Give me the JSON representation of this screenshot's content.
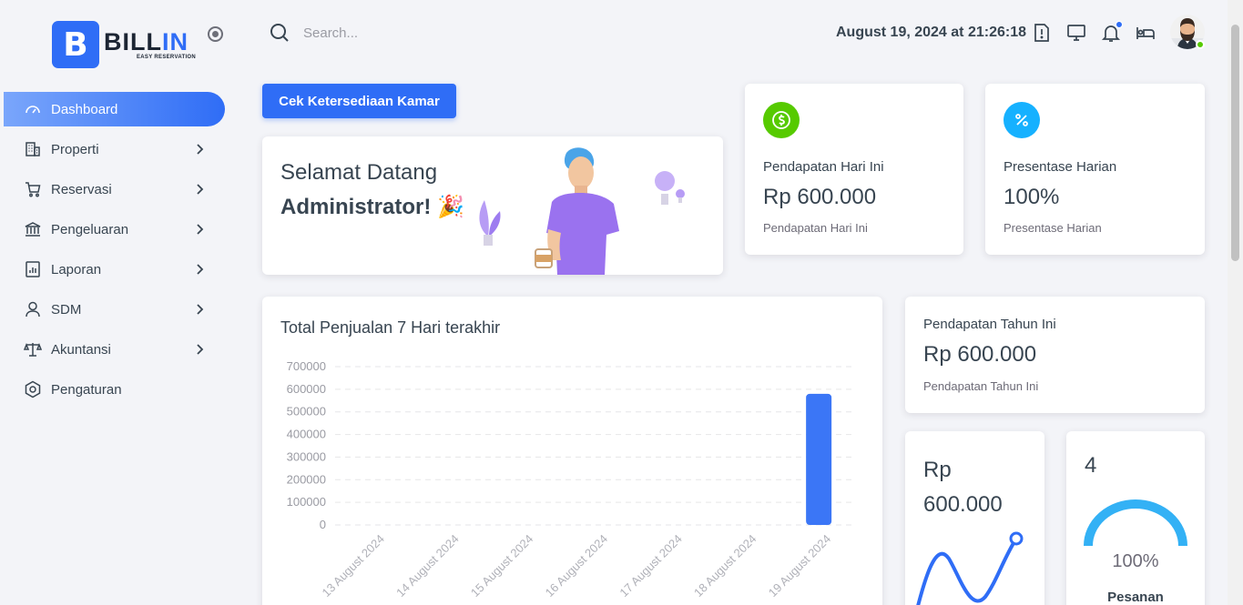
{
  "brand": {
    "name_prefix": "BILL",
    "name_suffix": "IN",
    "tagline": "EASY RESERVATION",
    "mark": "B",
    "accent": "#2f6df6"
  },
  "sidebar": {
    "items": [
      {
        "label": "Dashboard",
        "icon": "dashboard-gauge-icon",
        "active": true,
        "has_children": false
      },
      {
        "label": "Properti",
        "icon": "building-icon",
        "has_children": true
      },
      {
        "label": "Reservasi",
        "icon": "cart-icon",
        "has_children": true
      },
      {
        "label": "Pengeluaran",
        "icon": "bank-icon",
        "has_children": true
      },
      {
        "label": "Laporan",
        "icon": "report-icon",
        "has_children": true
      },
      {
        "label": "SDM",
        "icon": "user-icon",
        "has_children": true
      },
      {
        "label": "Akuntansi",
        "icon": "scale-icon",
        "has_children": true
      },
      {
        "label": "Pengaturan",
        "icon": "settings-hex-icon",
        "has_children": false
      }
    ]
  },
  "header": {
    "search_placeholder": "Search...",
    "datetime": "August 19, 2024 at 21:26:18"
  },
  "actions": {
    "check_availability": "Cek Ketersediaan Kamar"
  },
  "welcome": {
    "line1": "Selamat Datang",
    "line2": "Administrator! 🎉"
  },
  "stats": {
    "today": {
      "title": "Pendapatan Hari Ini",
      "value": "Rp 600.000",
      "sub": "Pendapatan Hari Ini",
      "icon_glyph": "$",
      "color": "#56ca00"
    },
    "daily": {
      "title": "Presentase Harian",
      "value": "100%",
      "sub": "Presentase Harian",
      "icon_glyph": "%",
      "color": "#16b1ff"
    },
    "year": {
      "title": "Pendapatan Tahun Ini",
      "value": "Rp 600.000",
      "sub": "Pendapatan Tahun Ini"
    },
    "revenue_small": {
      "line1": "Rp",
      "line2": "600.000"
    },
    "orders": {
      "count": "4",
      "percent": "100%",
      "label": "Pesanan",
      "percent_value": 100
    }
  },
  "chart_data": {
    "type": "bar",
    "title": "Total Penjualan 7 Hari terakhir",
    "categories": [
      "13 August 2024",
      "14 August 2024",
      "15 August 2024",
      "16 August 2024",
      "17 August 2024",
      "18 August 2024",
      "19 August 2024"
    ],
    "values": [
      0,
      0,
      0,
      0,
      0,
      0,
      580000
    ],
    "yticks": [
      "700000",
      "600000",
      "500000",
      "400000",
      "300000",
      "200000",
      "100000",
      "0"
    ],
    "ylim": [
      0,
      700000
    ],
    "grid": true,
    "bar_color": "#3b76f6"
  }
}
